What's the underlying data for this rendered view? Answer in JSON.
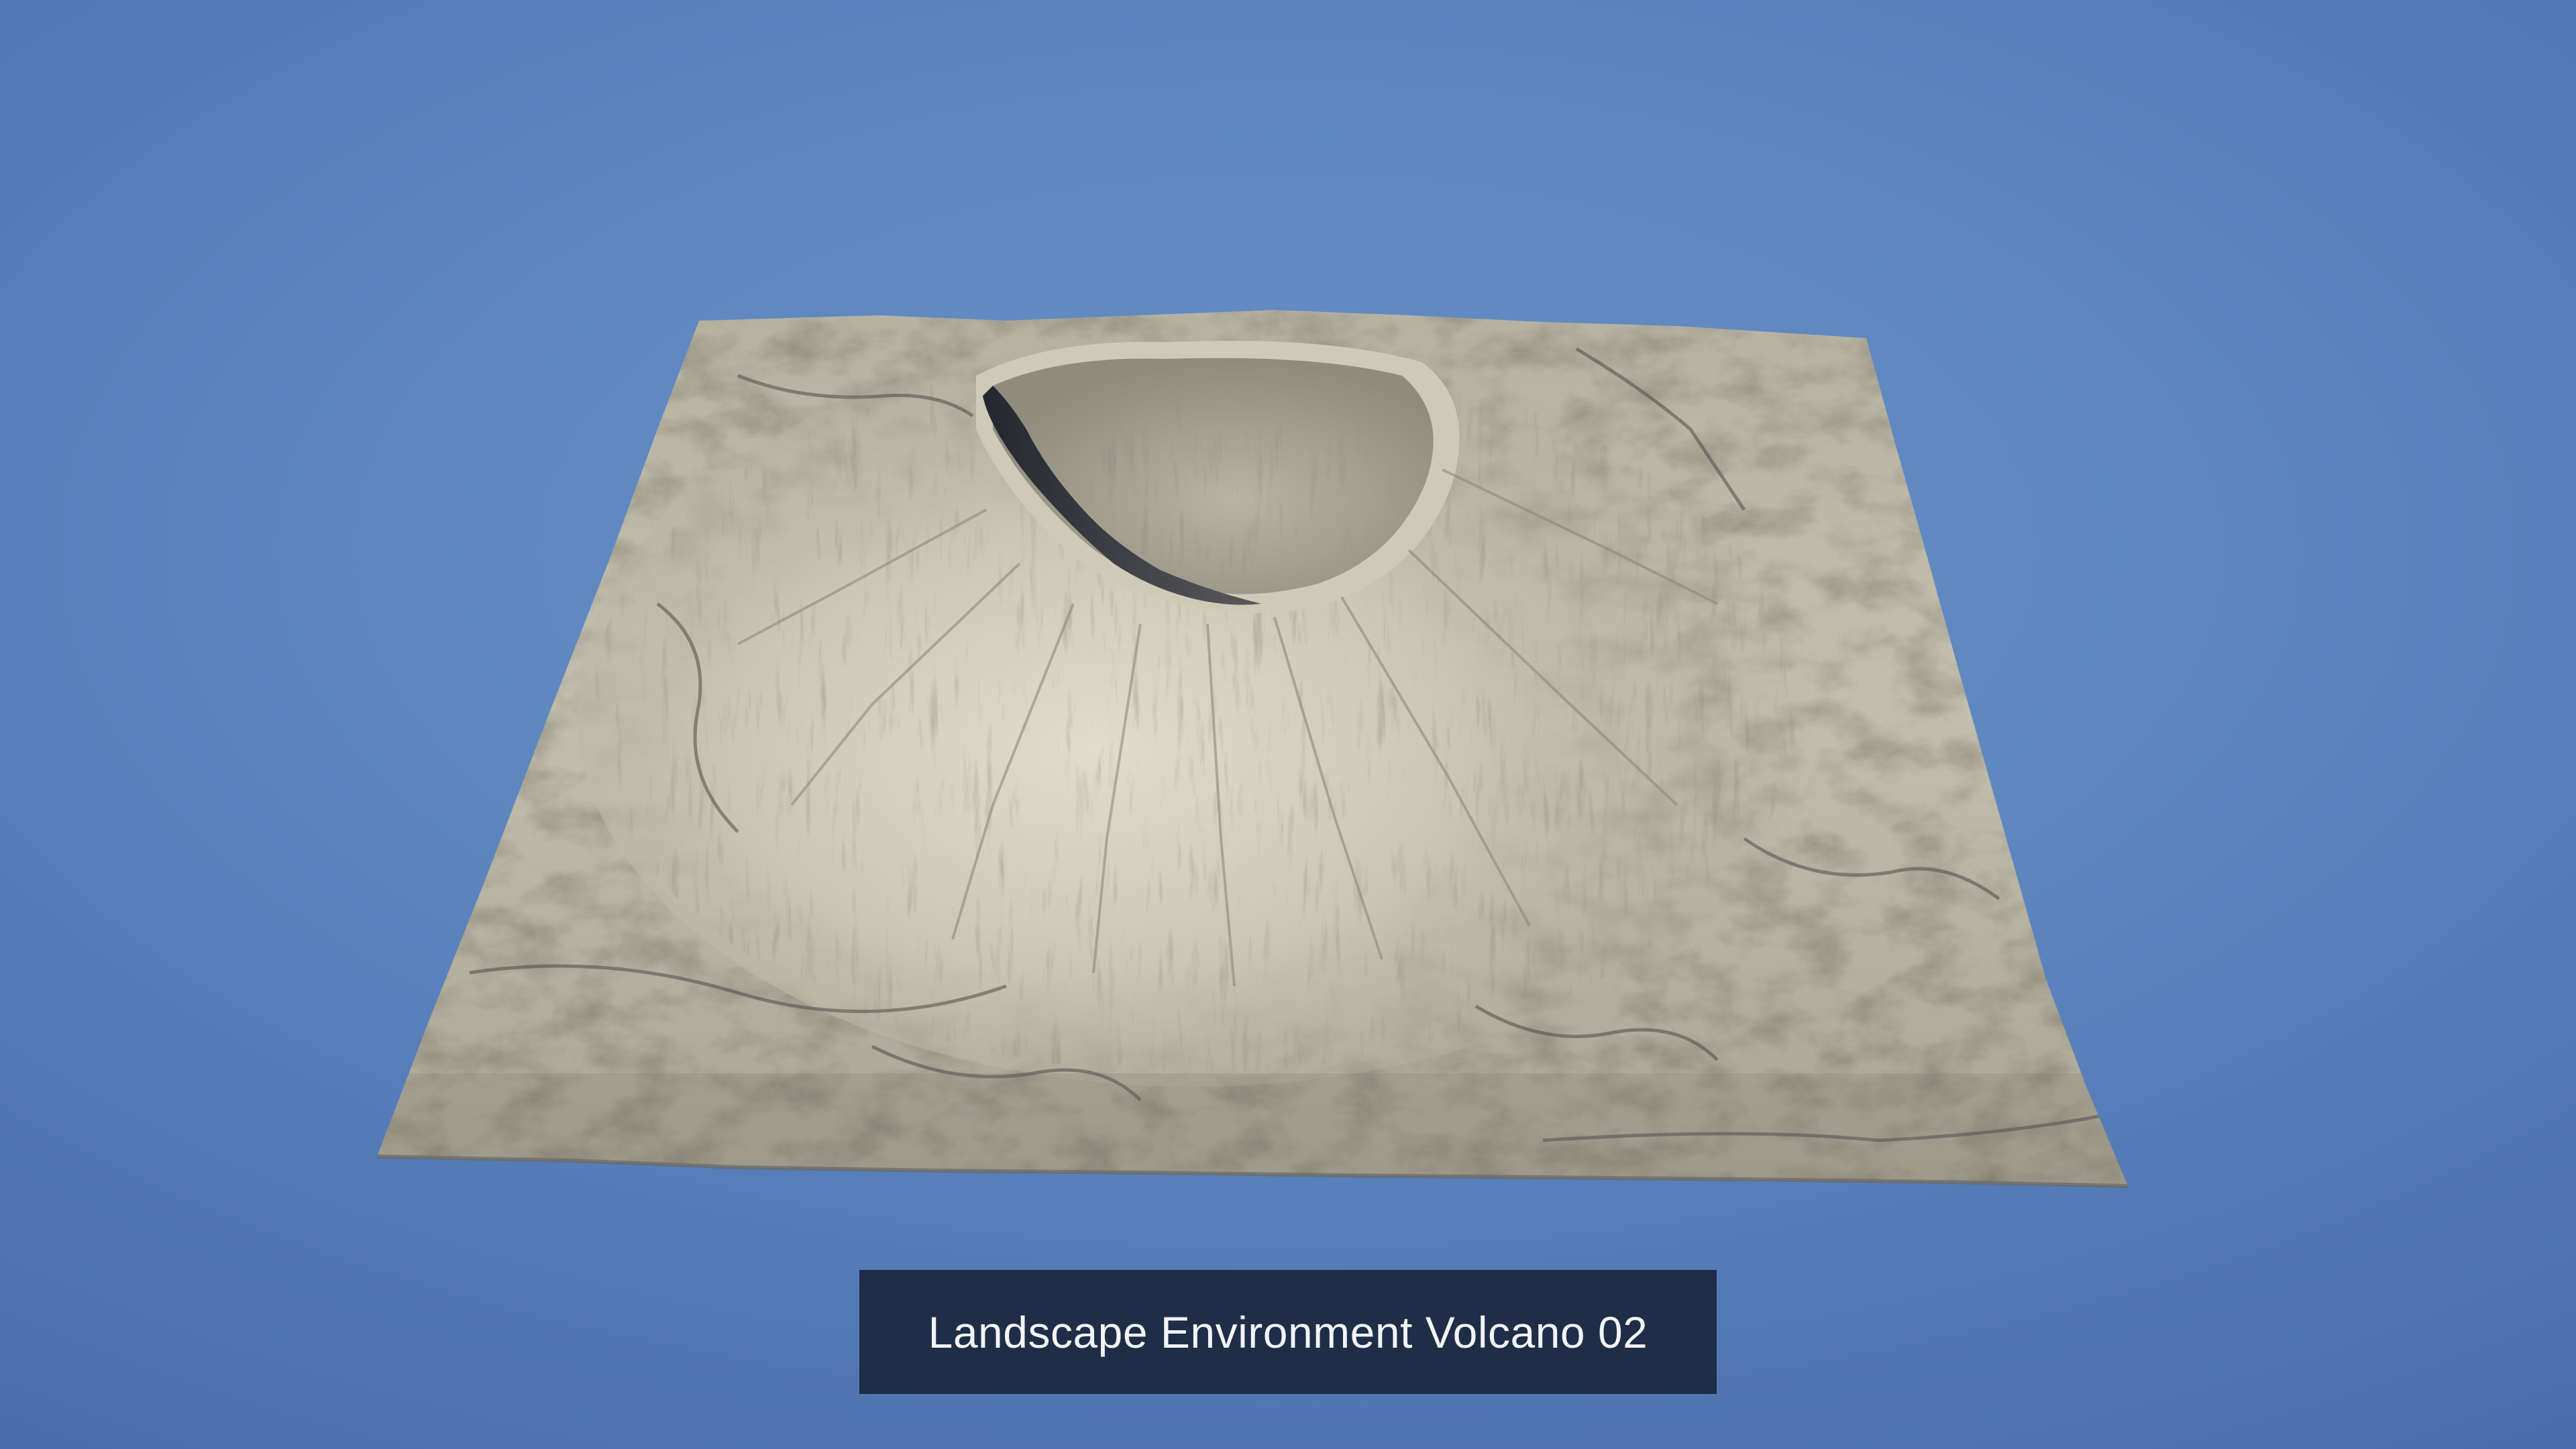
{
  "caption": {
    "text": "Landscape Environment Volcano 02"
  },
  "scene": {
    "subject": "volcano-terrain",
    "background_color": "#5d86bf",
    "terrain_color": "#bdb8a6",
    "terrain_shadow_color": "#3a3c42",
    "caption_background_color": "#1f2d47",
    "caption_text_color": "#f2f4f8"
  }
}
